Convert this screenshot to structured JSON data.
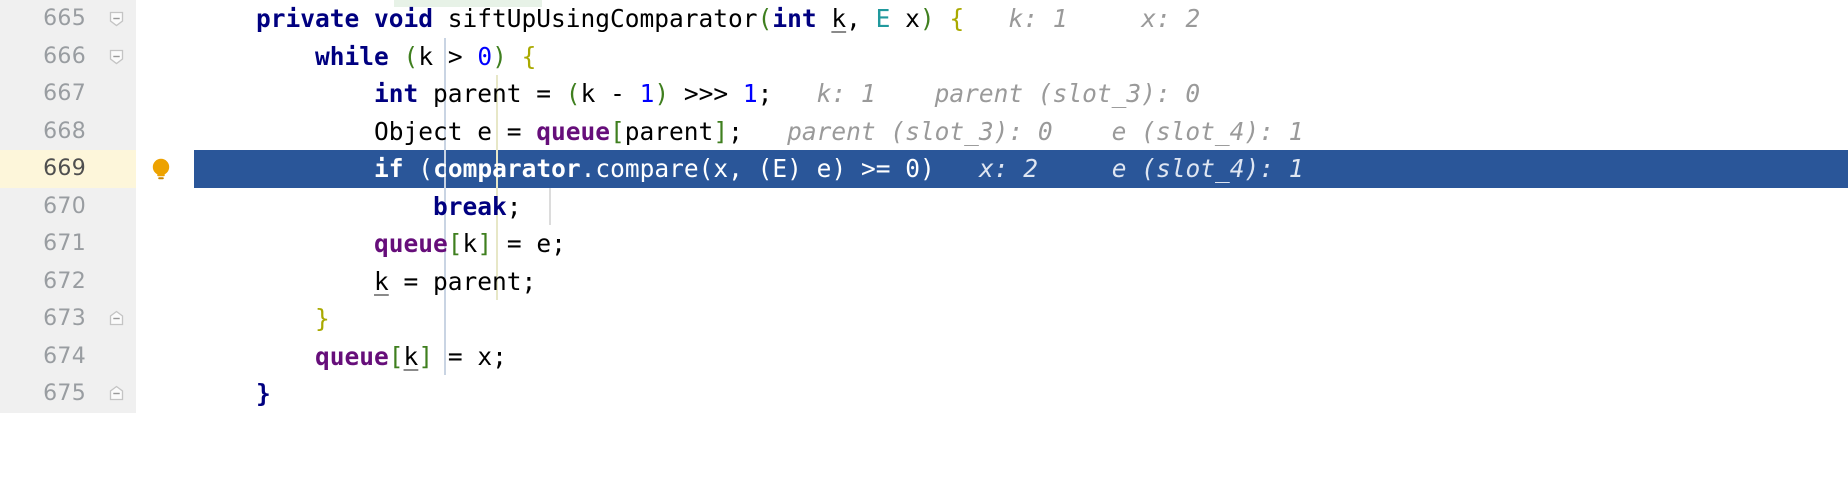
{
  "editor": {
    "app": "IntelliJ IDEA debugger editor",
    "colors": {
      "gutter_bg": "#f0f0f0",
      "editor_bg": "#ffffff",
      "highlight_bg": "#2a5699",
      "highlight_gutter_bg": "#fdf6da",
      "line_number": "#999da1",
      "keyword": "#000080",
      "field": "#660e7a",
      "class_ref": "#20999d",
      "number": "#0000ff",
      "bracket": "#3f7f1f",
      "brace": "#a9a900",
      "inline_hint": "#9a9a9a",
      "bulb": "#eda200"
    },
    "lines": [
      {
        "number": "665",
        "fold": "collapse-top",
        "icon": "",
        "highlighted": false,
        "indent": 0,
        "tokens": [
          {
            "t": "private",
            "c": "kw"
          },
          {
            "t": " ",
            "c": "plain"
          },
          {
            "t": "void",
            "c": "kw"
          },
          {
            "t": " siftUpUsingComparator",
            "c": "plain"
          },
          {
            "t": "(",
            "c": "paren"
          },
          {
            "t": "int",
            "c": "kw"
          },
          {
            "t": " ",
            "c": "plain"
          },
          {
            "t": "k",
            "c": "plain und"
          },
          {
            "t": ", ",
            "c": "plain"
          },
          {
            "t": "E",
            "c": "cls"
          },
          {
            "t": " x",
            "c": "plain"
          },
          {
            "t": ")",
            "c": "paren"
          },
          {
            "t": " ",
            "c": "plain"
          },
          {
            "t": "{",
            "c": "brc"
          },
          {
            "t": "   k: 1     x: 2",
            "c": "hint"
          }
        ]
      },
      {
        "number": "666",
        "fold": "collapse-top",
        "icon": "",
        "highlighted": false,
        "indent": 1,
        "tokens": [
          {
            "t": "    ",
            "c": "plain"
          },
          {
            "t": "while",
            "c": "kw"
          },
          {
            "t": " ",
            "c": "plain"
          },
          {
            "t": "(",
            "c": "paren"
          },
          {
            "t": "k > ",
            "c": "plain"
          },
          {
            "t": "0",
            "c": "num"
          },
          {
            "t": ")",
            "c": "paren"
          },
          {
            "t": " ",
            "c": "plain"
          },
          {
            "t": "{",
            "c": "brc"
          }
        ]
      },
      {
        "number": "667",
        "fold": "",
        "icon": "",
        "highlighted": false,
        "indent": 2,
        "tokens": [
          {
            "t": "        ",
            "c": "plain"
          },
          {
            "t": "int",
            "c": "kw"
          },
          {
            "t": " parent = ",
            "c": "plain"
          },
          {
            "t": "(",
            "c": "paren"
          },
          {
            "t": "k - ",
            "c": "plain"
          },
          {
            "t": "1",
            "c": "num"
          },
          {
            "t": ")",
            "c": "paren"
          },
          {
            "t": " >>> ",
            "c": "plain"
          },
          {
            "t": "1",
            "c": "num"
          },
          {
            "t": ";",
            "c": "plain"
          },
          {
            "t": "   k: 1    parent (slot_3): 0",
            "c": "hint"
          }
        ]
      },
      {
        "number": "668",
        "fold": "",
        "icon": "",
        "highlighted": false,
        "indent": 2,
        "tokens": [
          {
            "t": "        Object e = ",
            "c": "plain"
          },
          {
            "t": "queue",
            "c": "fld"
          },
          {
            "t": "[",
            "c": "brk"
          },
          {
            "t": "parent",
            "c": "plain"
          },
          {
            "t": "]",
            "c": "brk"
          },
          {
            "t": ";",
            "c": "plain"
          },
          {
            "t": "   parent (slot_3): 0    e (slot_4): 1",
            "c": "hint"
          }
        ]
      },
      {
        "number": "669",
        "fold": "",
        "icon": "lightbulb-icon",
        "highlighted": true,
        "indent": 2,
        "tokens": [
          {
            "t": "        ",
            "c": "plain"
          },
          {
            "t": "if",
            "c": "kw"
          },
          {
            "t": " ",
            "c": "plain"
          },
          {
            "t": "(",
            "c": "paren"
          },
          {
            "t": "comparator",
            "c": "fld"
          },
          {
            "t": ".compare",
            "c": "plain"
          },
          {
            "t": "(",
            "c": "paren"
          },
          {
            "t": "x, ",
            "c": "plain"
          },
          {
            "t": "(",
            "c": "paren"
          },
          {
            "t": "E",
            "c": "cls"
          },
          {
            "t": ")",
            "c": "paren"
          },
          {
            "t": " e",
            "c": "plain"
          },
          {
            "t": ")",
            "c": "paren"
          },
          {
            "t": " >= ",
            "c": "plain"
          },
          {
            "t": "0",
            "c": "num"
          },
          {
            "t": ")",
            "c": "paren"
          },
          {
            "t": "   x: 2     e (slot_4): 1",
            "c": "hint"
          }
        ]
      },
      {
        "number": "670",
        "fold": "",
        "icon": "",
        "highlighted": false,
        "indent": 3,
        "tokens": [
          {
            "t": "            ",
            "c": "plain"
          },
          {
            "t": "break",
            "c": "kw"
          },
          {
            "t": ";",
            "c": "plain"
          }
        ]
      },
      {
        "number": "671",
        "fold": "",
        "icon": "",
        "highlighted": false,
        "indent": 2,
        "tokens": [
          {
            "t": "        ",
            "c": "plain"
          },
          {
            "t": "queue",
            "c": "fld"
          },
          {
            "t": "[",
            "c": "brk"
          },
          {
            "t": "k",
            "c": "plain"
          },
          {
            "t": "]",
            "c": "brk"
          },
          {
            "t": " = e;",
            "c": "plain"
          }
        ]
      },
      {
        "number": "672",
        "fold": "",
        "icon": "",
        "highlighted": false,
        "indent": 2,
        "tokens": [
          {
            "t": "        ",
            "c": "plain"
          },
          {
            "t": "k",
            "c": "plain und"
          },
          {
            "t": " = parent;",
            "c": "plain"
          }
        ]
      },
      {
        "number": "673",
        "fold": "collapse-bottom",
        "icon": "",
        "highlighted": false,
        "indent": 1,
        "tokens": [
          {
            "t": "    ",
            "c": "plain"
          },
          {
            "t": "}",
            "c": "brc"
          }
        ]
      },
      {
        "number": "674",
        "fold": "",
        "icon": "",
        "highlighted": false,
        "indent": 1,
        "tokens": [
          {
            "t": "    ",
            "c": "plain"
          },
          {
            "t": "queue",
            "c": "fld"
          },
          {
            "t": "[",
            "c": "brk"
          },
          {
            "t": "k",
            "c": "plain und"
          },
          {
            "t": "]",
            "c": "brk"
          },
          {
            "t": " = x;",
            "c": "plain"
          }
        ]
      },
      {
        "number": "675",
        "fold": "collapse-bottom",
        "icon": "",
        "highlighted": false,
        "indent": 0,
        "tokens": [
          {
            "t": "",
            "c": "plain"
          },
          {
            "t": "}",
            "c": "kw"
          }
        ]
      }
    ]
  }
}
